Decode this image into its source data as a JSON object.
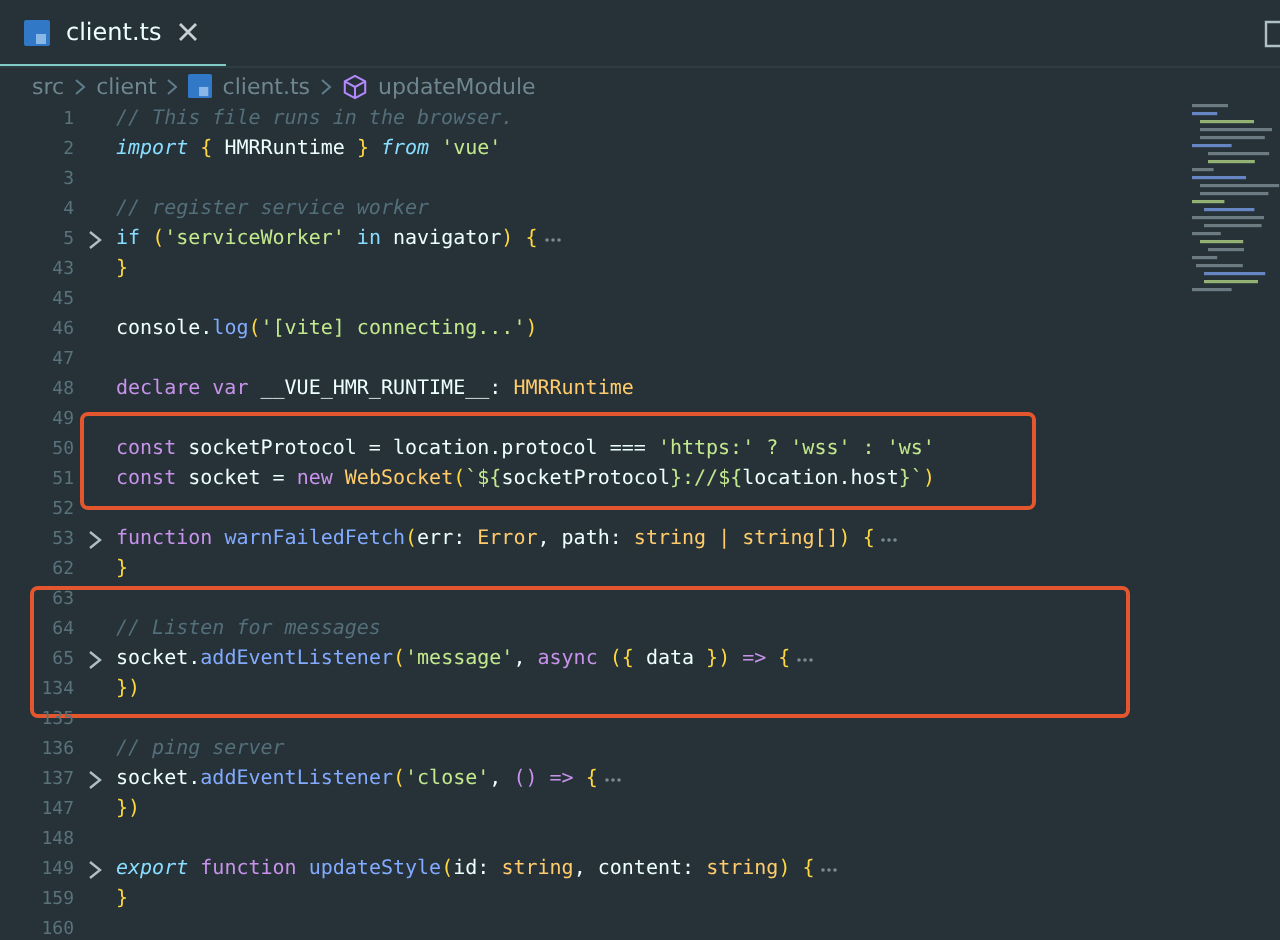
{
  "editor": {
    "tab": {
      "label": "client.ts",
      "selected": true
    },
    "breadcrumbs": [
      {
        "label": "src",
        "kind": "folder"
      },
      {
        "label": "client",
        "kind": "folder"
      },
      {
        "label": "client.ts",
        "kind": "file"
      },
      {
        "label": "updateModule",
        "kind": "symbol"
      }
    ],
    "blocks": [
      {
        "kind": "plain",
        "lines": [
          {
            "number": "1",
            "folded": false,
            "tokens": [
              {
                "text": "// This file runs in the browser.",
                "kind": "comment"
              }
            ]
          },
          {
            "number": "2",
            "folded": false,
            "tokens": [
              {
                "text": "import ",
                "kind": "kwi"
              },
              {
                "text": "{ ",
                "kind": "brace"
              },
              {
                "text": "HMRRuntime ",
                "kind": "plain"
              },
              {
                "text": "} ",
                "kind": "brace"
              },
              {
                "text": "from ",
                "kind": "kwi"
              },
              {
                "text": "'vue'",
                "kind": "str"
              }
            ]
          },
          {
            "number": "3",
            "folded": false
          },
          {
            "number": "4",
            "folded": false,
            "tokens": [
              {
                "text": "// register service worker",
                "kind": "comment"
              }
            ]
          },
          {
            "number": "5",
            "folded": true,
            "tokens": [
              {
                "text": "if ",
                "kind": "ctl"
              },
              {
                "text": "(",
                "kind": "brace"
              },
              {
                "text": "'serviceWorker' ",
                "kind": "str"
              },
              {
                "text": "in ",
                "kind": "ctl"
              },
              {
                "text": "navigator",
                "kind": "plain"
              },
              {
                "text": ") {",
                "kind": "brace"
              }
            ]
          },
          {
            "number": "43",
            "folded": false,
            "tokens": [
              {
                "text": "}",
                "kind": "brace"
              }
            ]
          },
          {
            "number": "45",
            "folded": false
          },
          {
            "number": "46",
            "folded": false,
            "tokens": [
              {
                "text": "console.",
                "kind": "plain"
              },
              {
                "text": "log",
                "kind": "fn"
              },
              {
                "text": "(",
                "kind": "brace"
              },
              {
                "text": "'[vite] connecting...'",
                "kind": "str"
              },
              {
                "text": ")",
                "kind": "brace"
              }
            ]
          },
          {
            "number": "47",
            "folded": false
          },
          {
            "number": "48",
            "folded": false,
            "tokens": [
              {
                "text": "declare var ",
                "kind": "kw"
              },
              {
                "text": "__VUE_HMR_RUNTIME__: ",
                "kind": "plain"
              },
              {
                "text": "HMRRuntime",
                "kind": "type"
              }
            ]
          },
          {
            "number": "49",
            "folded": false
          }
        ]
      },
      {
        "kind": "highlight",
        "lines": [
          {
            "number": "50",
            "folded": false,
            "tokens": [
              {
                "text": "const ",
                "kind": "kw"
              },
              {
                "text": "socketProtocol = location.protocol === ",
                "kind": "plain"
              },
              {
                "text": "'https:' ? 'wss' : 'ws'",
                "kind": "str"
              }
            ]
          },
          {
            "number": "51",
            "folded": false,
            "tokens": [
              {
                "text": "const ",
                "kind": "kw"
              },
              {
                "text": "socket = ",
                "kind": "plain"
              },
              {
                "text": "new ",
                "kind": "kw"
              },
              {
                "text": "WebSocket",
                "kind": "type"
              },
              {
                "text": "(",
                "kind": "brace"
              },
              {
                "text": "`${",
                "kind": "str"
              },
              {
                "text": "socketProtocol",
                "kind": "plain"
              },
              {
                "text": "}://${",
                "kind": "str"
              },
              {
                "text": "location.host",
                "kind": "plain"
              },
              {
                "text": "}`",
                "kind": "str"
              },
              {
                "text": ")",
                "kind": "brace"
              }
            ]
          }
        ]
      },
      {
        "kind": "plain",
        "lines": [
          {
            "number": "52",
            "folded": false
          },
          {
            "number": "53",
            "folded": true,
            "tokens": [
              {
                "text": "function ",
                "kind": "kw"
              },
              {
                "text": "warnFailedFetch",
                "kind": "fn"
              },
              {
                "text": "(",
                "kind": "brace"
              },
              {
                "text": "err: ",
                "kind": "plain"
              },
              {
                "text": "Error",
                "kind": "type"
              },
              {
                "text": ", path: ",
                "kind": "plain"
              },
              {
                "text": "string | string[]",
                "kind": "type"
              },
              {
                "text": ") {",
                "kind": "brace"
              }
            ]
          },
          {
            "number": "62",
            "folded": false,
            "tokens": [
              {
                "text": "}",
                "kind": "brace"
              }
            ]
          },
          {
            "number": "63",
            "folded": false
          }
        ]
      },
      {
        "kind": "highlight",
        "lines": [
          {
            "number": "64",
            "folded": false,
            "tokens": [
              {
                "text": "// Listen for messages",
                "kind": "comment"
              }
            ]
          },
          {
            "number": "65",
            "folded": true,
            "tokens": [
              {
                "text": "socket.",
                "kind": "plain"
              },
              {
                "text": "addEventListener",
                "kind": "fn"
              },
              {
                "text": "(",
                "kind": "brace"
              },
              {
                "text": "'message'",
                "kind": "str"
              },
              {
                "text": ", ",
                "kind": "plain"
              },
              {
                "text": "async ",
                "kind": "kw"
              },
              {
                "text": "({ ",
                "kind": "brace"
              },
              {
                "text": "data ",
                "kind": "plain"
              },
              {
                "text": "}) ",
                "kind": "brace"
              },
              {
                "text": "=> ",
                "kind": "kw"
              },
              {
                "text": "{",
                "kind": "brace"
              }
            ]
          },
          {
            "number": "134",
            "folded": false,
            "tokens": [
              {
                "text": "})",
                "kind": "brace"
              }
            ]
          }
        ]
      },
      {
        "kind": "plain",
        "lines": [
          {
            "number": "135",
            "folded": false
          },
          {
            "number": "136",
            "folded": false,
            "tokens": [
              {
                "text": "// ping server",
                "kind": "comment"
              }
            ]
          },
          {
            "number": "137",
            "folded": true,
            "tokens": [
              {
                "text": "socket.",
                "kind": "plain"
              },
              {
                "text": "addEventListener",
                "kind": "fn"
              },
              {
                "text": "(",
                "kind": "brace"
              },
              {
                "text": "'close'",
                "kind": "str"
              },
              {
                "text": ", ",
                "kind": "plain"
              },
              {
                "text": "() => ",
                "kind": "kw"
              },
              {
                "text": "{",
                "kind": "brace"
              }
            ]
          },
          {
            "number": "147",
            "folded": false,
            "tokens": [
              {
                "text": "})",
                "kind": "brace"
              }
            ]
          },
          {
            "number": "148",
            "folded": false
          },
          {
            "number": "149",
            "folded": true,
            "tokens": [
              {
                "text": "export ",
                "kind": "kwi"
              },
              {
                "text": "function ",
                "kind": "kw"
              },
              {
                "text": "updateStyle",
                "kind": "fn"
              },
              {
                "text": "(",
                "kind": "brace"
              },
              {
                "text": "id: ",
                "kind": "plain"
              },
              {
                "text": "string",
                "kind": "type"
              },
              {
                "text": ", content: ",
                "kind": "plain"
              },
              {
                "text": "string",
                "kind": "type"
              },
              {
                "text": ") {",
                "kind": "brace"
              }
            ]
          },
          {
            "number": "159",
            "folded": false,
            "tokens": [
              {
                "text": "}",
                "kind": "brace"
              }
            ]
          },
          {
            "number": "160",
            "folded": false
          }
        ]
      }
    ]
  }
}
